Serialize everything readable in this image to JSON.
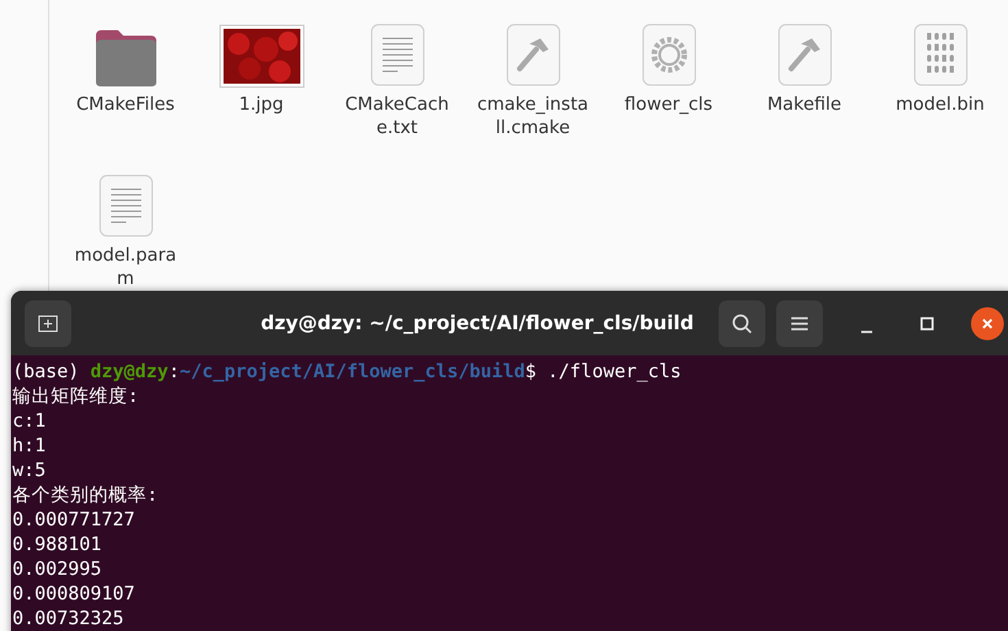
{
  "files": [
    {
      "name": "CMakeFiles",
      "kind": "folder"
    },
    {
      "name": "1.jpg",
      "kind": "image"
    },
    {
      "name": "CMakeCache.txt",
      "kind": "text"
    },
    {
      "name": "cmake_install.cmake",
      "kind": "script"
    },
    {
      "name": "flower_cls",
      "kind": "executable"
    },
    {
      "name": "Makefile",
      "kind": "script"
    },
    {
      "name": "model.bin",
      "kind": "binary"
    },
    {
      "name": "model.param",
      "kind": "text"
    }
  ],
  "terminal": {
    "title": "dzy@dzy: ~/c_project/AI/flower_cls/build",
    "lines": [
      [
        {
          "text": "(base) ",
          "kind": "plain"
        },
        {
          "text": "dzy@dzy",
          "kind": "user"
        },
        {
          "text": ":",
          "kind": "plain"
        },
        {
          "text": "~/c_project/AI/flower_cls/build",
          "kind": "path"
        },
        {
          "text": "$ ./flower_cls",
          "kind": "plain"
        }
      ],
      [
        {
          "text": "输出矩阵维度:",
          "kind": "plain"
        }
      ],
      [
        {
          "text": "c:1",
          "kind": "plain"
        }
      ],
      [
        {
          "text": "h:1",
          "kind": "plain"
        }
      ],
      [
        {
          "text": "w:5",
          "kind": "plain"
        }
      ],
      [
        {
          "text": "各个类别的概率:",
          "kind": "plain"
        }
      ],
      [
        {
          "text": "0.000771727",
          "kind": "plain"
        }
      ],
      [
        {
          "text": "0.988101",
          "kind": "plain"
        }
      ],
      [
        {
          "text": "0.002995",
          "kind": "plain"
        }
      ],
      [
        {
          "text": "0.000809107",
          "kind": "plain"
        }
      ],
      [
        {
          "text": "0.00732325",
          "kind": "plain"
        }
      ]
    ]
  }
}
